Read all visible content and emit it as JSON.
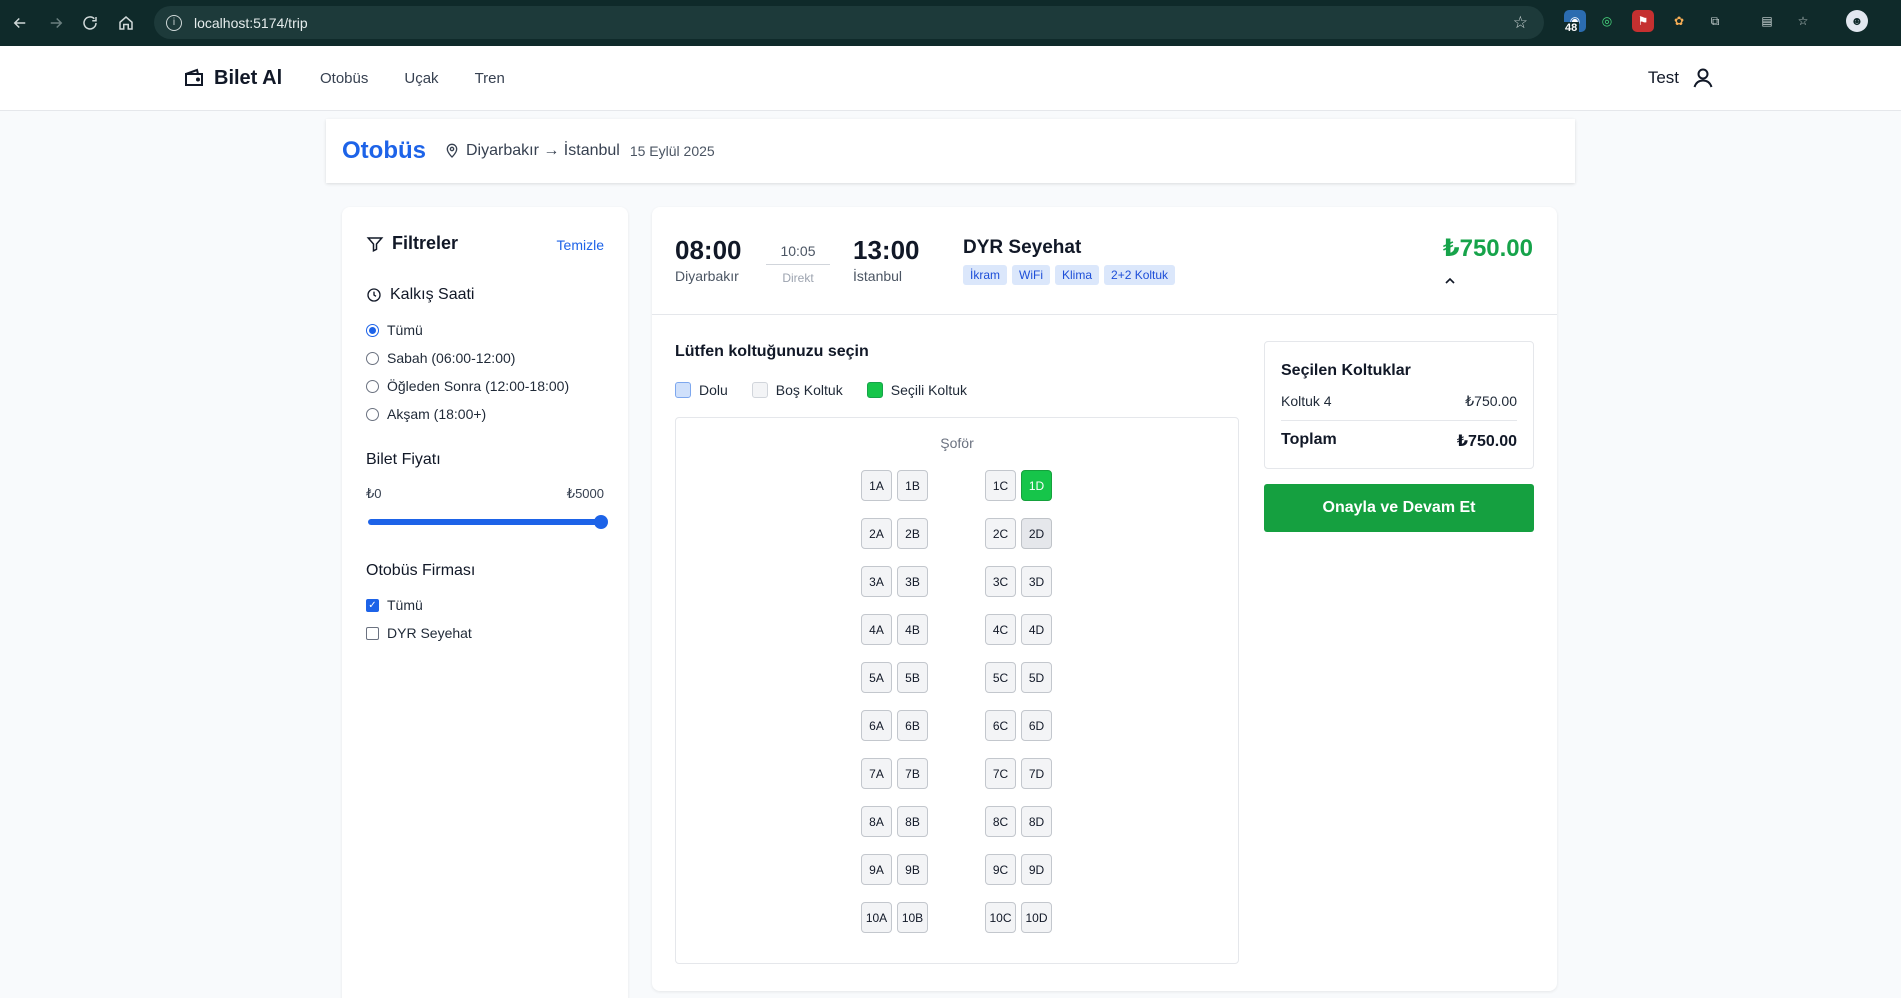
{
  "browser": {
    "url": "localhost:5174/trip",
    "ext_badge": "48"
  },
  "app": {
    "brand": "Bilet Al",
    "nav": [
      "Otobüs",
      "Uçak",
      "Tren"
    ],
    "user": "Test"
  },
  "title": {
    "heading": "Otobüs",
    "route": "Diyarbakır → İstanbul",
    "date": "15 Eylül 2025"
  },
  "filters": {
    "title": "Filtreler",
    "clear": "Temizle",
    "departure": {
      "title": "Kalkış Saati",
      "options": [
        {
          "label": "Tümü",
          "checked": true
        },
        {
          "label": "Sabah (06:00-12:00)",
          "checked": false
        },
        {
          "label": "Öğleden Sonra (12:00-18:00)",
          "checked": false
        },
        {
          "label": "Akşam (18:00+)",
          "checked": false
        }
      ]
    },
    "price": {
      "title": "Bilet Fiyatı",
      "min": "₺0",
      "max": "₺5000",
      "value_fraction": 1.0
    },
    "company": {
      "title": "Otobüs Firması",
      "options": [
        {
          "label": "Tümü",
          "checked": true
        },
        {
          "label": "DYR Seyehat",
          "checked": false
        }
      ]
    }
  },
  "trip": {
    "dep_time": "08:00",
    "dep_city": "Diyarbakır",
    "duration": "10:05",
    "kind": "Direkt",
    "arr_time": "13:00",
    "arr_city": "İstanbul",
    "company": "DYR Seyehat",
    "tags": [
      "İkram",
      "WiFi",
      "Klima",
      "2+2 Koltuk"
    ],
    "price": "₺750.00"
  },
  "seat_select": {
    "title": "Lütfen koltuğunuzu seçin",
    "legend": {
      "dolu": "Dolu",
      "bos": "Boş Koltuk",
      "secili": "Seçili Koltuk"
    },
    "driver": "Şoför",
    "rows": [
      [
        "1A",
        "1B",
        "1C",
        "1D"
      ],
      [
        "2A",
        "2B",
        "2C",
        "2D"
      ],
      [
        "3A",
        "3B",
        "3C",
        "3D"
      ],
      [
        "4A",
        "4B",
        "4C",
        "4D"
      ],
      [
        "5A",
        "5B",
        "5C",
        "5D"
      ],
      [
        "6A",
        "6B",
        "6C",
        "6D"
      ],
      [
        "7A",
        "7B",
        "7C",
        "7D"
      ],
      [
        "8A",
        "8B",
        "8C",
        "8D"
      ],
      [
        "9A",
        "9B",
        "9C",
        "9D"
      ],
      [
        "10A",
        "10B",
        "10C",
        "10D"
      ]
    ],
    "selected": [
      "1D"
    ],
    "taken": [
      "2D"
    ]
  },
  "summary": {
    "title": "Seçilen Koltuklar",
    "item_label": "Koltuk 4",
    "item_price": "₺750.00",
    "total_label": "Toplam",
    "total": "₺750.00",
    "confirm": "Onayla ve Devam Et"
  },
  "colors": {
    "primary": "#1d63e8",
    "success": "#16a34a",
    "chrome": "#0f2a2a"
  }
}
